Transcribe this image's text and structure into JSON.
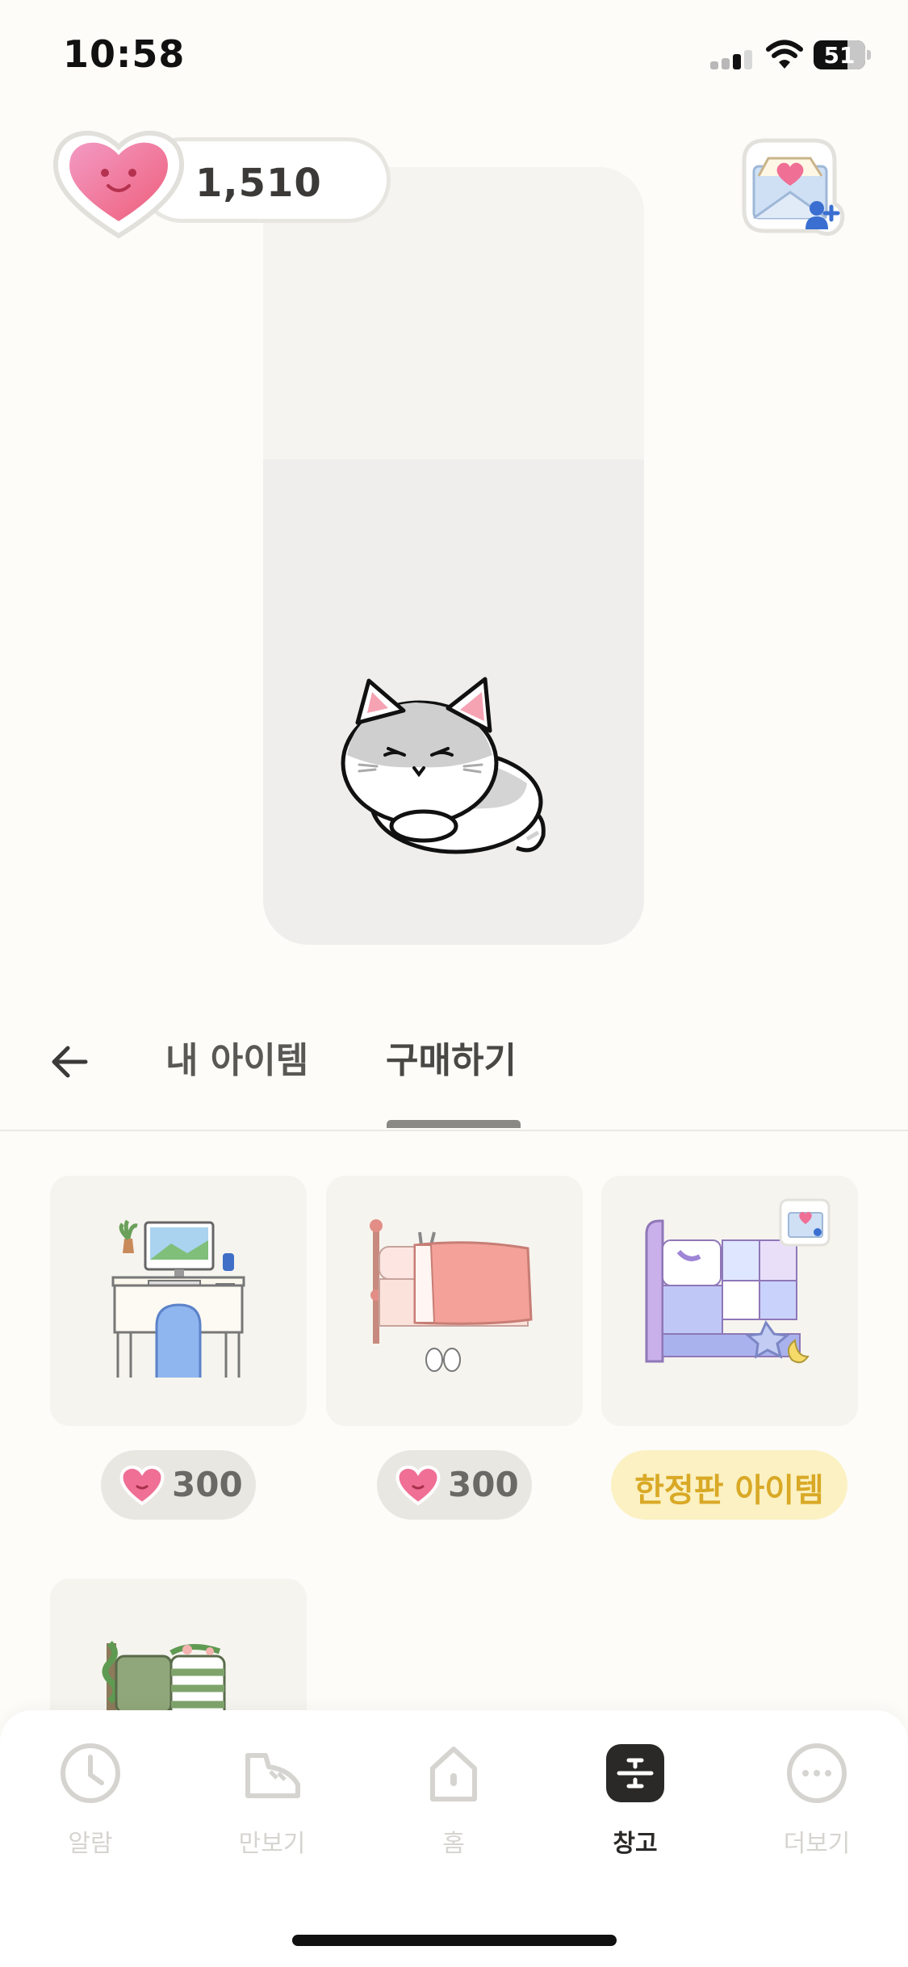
{
  "status_bar": {
    "time": "10:58",
    "battery_level": "51",
    "icons": [
      "signal-icon",
      "wifi-icon",
      "battery-icon"
    ]
  },
  "header": {
    "heart_count": "1,510",
    "heart_icon": "smiling-heart-icon",
    "invite_icon": "invite-letter-icon"
  },
  "room": {
    "character": "gray-cat-sleeping"
  },
  "tabs": {
    "back_icon": "back-arrow-icon",
    "items": [
      {
        "label": "내 아이템",
        "active": false
      },
      {
        "label": "구매하기",
        "active": true
      }
    ]
  },
  "shop": {
    "items": [
      {
        "name": "desk-set",
        "price": "300",
        "currency_icon": "heart-icon"
      },
      {
        "name": "pink-bed",
        "price": "300",
        "currency_icon": "heart-icon"
      },
      {
        "name": "starry-bed",
        "limited_label": "한정판 아이템",
        "badge_icon": "invite-letter-icon"
      },
      {
        "name": "green-bed"
      }
    ]
  },
  "bottom_nav": {
    "items": [
      {
        "label": "알람",
        "icon": "clock-icon",
        "active": false
      },
      {
        "label": "만보기",
        "icon": "sneaker-icon",
        "active": false
      },
      {
        "label": "홈",
        "icon": "home-icon",
        "active": false
      },
      {
        "label": "창고",
        "icon": "storage-icon",
        "active": true
      },
      {
        "label": "더보기",
        "icon": "more-icon",
        "active": false
      }
    ]
  },
  "colors": {
    "background": "#fdfcf8",
    "heart_pink": "#ef6f95",
    "limited_yellow": "#fbf1c2",
    "limited_text": "#d9a926"
  }
}
